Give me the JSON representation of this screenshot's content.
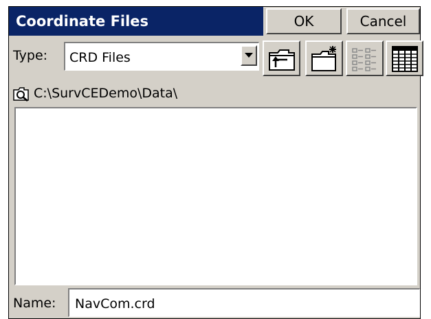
{
  "window": {
    "title": "Coordinate Files"
  },
  "buttons": {
    "ok_label": "OK",
    "cancel_label": "Cancel"
  },
  "type_filter": {
    "label": "Type:",
    "selected_value": "CRD Files"
  },
  "toolbar": {
    "icons": [
      "folder-up-icon",
      "new-folder-icon",
      "list-view-icon",
      "details-view-icon"
    ]
  },
  "path": {
    "icon": "folder-search-icon",
    "value": "C:\\SurvCEDemo\\Data\\"
  },
  "file_list": {
    "items": []
  },
  "name_field": {
    "label": "Name:",
    "value": "NavCom.crd"
  },
  "colors": {
    "titlebar": "#0a2466",
    "dialog_face": "#d4d0c8",
    "field_background": "#ffffff"
  }
}
